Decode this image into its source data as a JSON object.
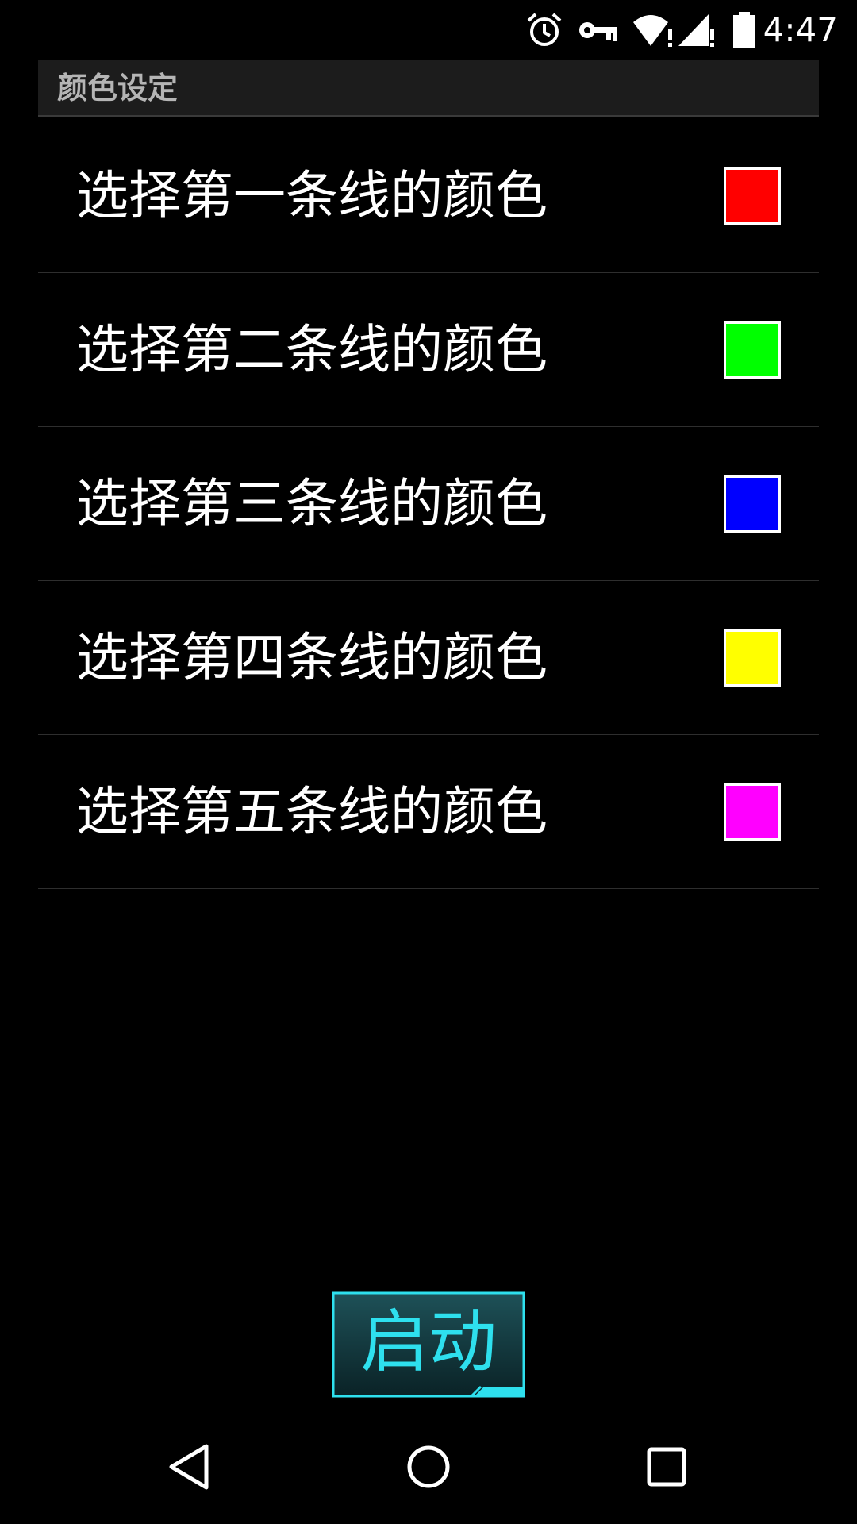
{
  "status_bar": {
    "time": "4:47",
    "icons": [
      "alarm-icon",
      "vpn-key-icon",
      "wifi-alert-icon",
      "signal-alert-icon",
      "battery-icon"
    ]
  },
  "header": {
    "title": "颜色设定"
  },
  "color_items": [
    {
      "label": "选择第一条线的颜色",
      "color": "#ff0000"
    },
    {
      "label": "选择第二条线的颜色",
      "color": "#00ff00"
    },
    {
      "label": "选择第三条线的颜色",
      "color": "#0000ff"
    },
    {
      "label": "选择第四条线的颜色",
      "color": "#ffff00"
    },
    {
      "label": "选择第五条线的颜色",
      "color": "#ff00ff"
    }
  ],
  "start_button": {
    "label": "启动",
    "accent_color": "#2ee0ee"
  },
  "nav_bar": {
    "icons": [
      "back-icon",
      "home-icon",
      "recent-apps-icon"
    ]
  }
}
